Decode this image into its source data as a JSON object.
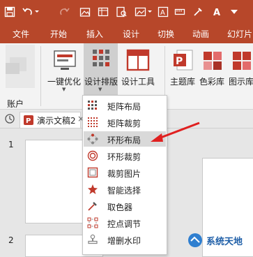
{
  "ribbon_tabs": [
    "文件",
    "开始",
    "插入",
    "设计",
    "切换",
    "动画",
    "幻灯片"
  ],
  "ribbon": {
    "account_label": "账户",
    "yijian_label": "一键优化",
    "design_label": "设计排版",
    "tools_label": "设计工具",
    "theme_label": "主题库",
    "color_label": "色彩库",
    "icon_label": "图示库"
  },
  "document": {
    "tab_title": "演示文稿2",
    "close_glyph": "×"
  },
  "slides": {
    "numbers": [
      "1",
      "2"
    ]
  },
  "menu": {
    "items": [
      {
        "label": "矩阵布局",
        "icon": "matrix-icon"
      },
      {
        "label": "矩阵裁剪",
        "icon": "matrix-crop-icon"
      },
      {
        "label": "环形布局",
        "icon": "ring-layout-icon"
      },
      {
        "label": "环形裁剪",
        "icon": "ring-crop-icon"
      },
      {
        "label": "裁剪图片",
        "icon": "crop-icon"
      },
      {
        "label": "智能选择",
        "icon": "star-icon"
      },
      {
        "label": "取色器",
        "icon": "eyedropper-icon"
      },
      {
        "label": "控点调节",
        "icon": "handle-icon"
      },
      {
        "label": "增删水印",
        "icon": "stamp-icon"
      }
    ],
    "highlighted_index": 2
  },
  "watermark": {
    "text": "系统天地"
  },
  "colors": {
    "accent": "#b7472a",
    "ribbon": "#f3f3f3",
    "pressed": "#cfcfcf",
    "arrow": "#e02020"
  }
}
